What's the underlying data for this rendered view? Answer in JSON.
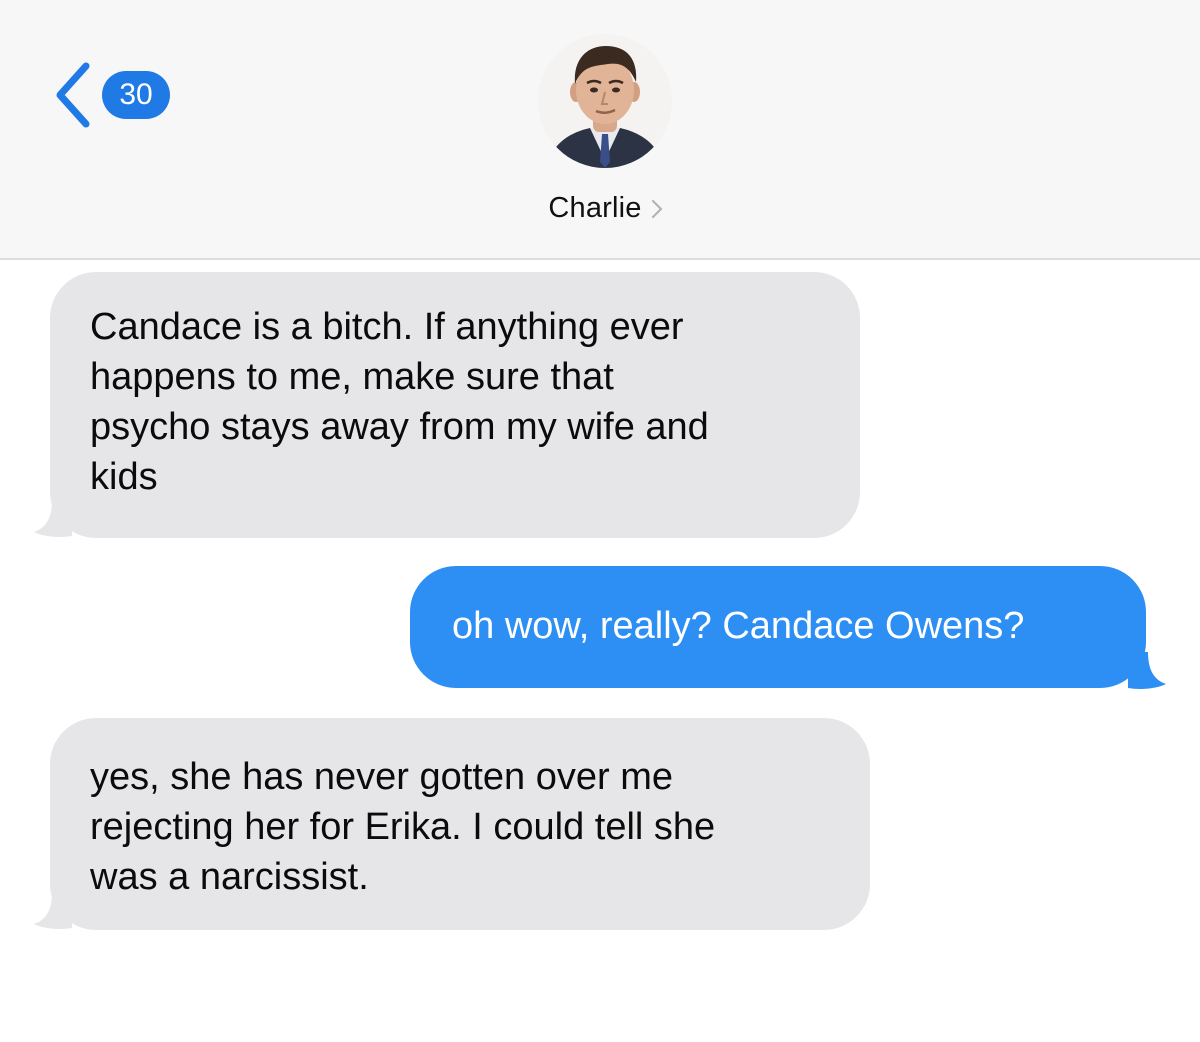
{
  "header": {
    "back_badge_count": "30",
    "contact_name": "Charlie",
    "icons": {
      "back": "chevron-left-icon",
      "details": "chevron-right-icon",
      "avatar": "contact-photo"
    }
  },
  "messages": [
    {
      "direction": "received",
      "text": "Candace is a bitch. If anything ever\nhappens to me, make sure that\npsycho stays away from my wife and\nkids"
    },
    {
      "direction": "sent",
      "text": "oh wow, really? Candace Owens?"
    },
    {
      "direction": "received",
      "text": "yes, she has never gotten over me\nrejecting her for Erika. I could tell she\nwas a narcissist."
    }
  ],
  "colors": {
    "accent": "#1f7ae6",
    "sent_bubble": "#2d8ff4",
    "received_bubble": "#e6e6e9",
    "header_bg": "#f7f7f7"
  }
}
